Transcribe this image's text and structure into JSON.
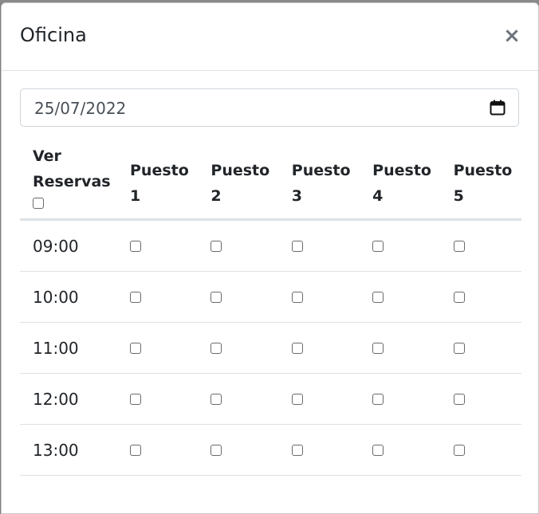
{
  "modal": {
    "title": "Oficina",
    "close_label": "×"
  },
  "date_field": {
    "value": "25/07/2022",
    "icon": "calendar-icon"
  },
  "table": {
    "first_header_line1": "Ver",
    "first_header_line2": "Reservas",
    "headers": [
      {
        "line1": "Puesto",
        "line2": "1"
      },
      {
        "line1": "Puesto",
        "line2": "2"
      },
      {
        "line1": "Puesto",
        "line2": "3"
      },
      {
        "line1": "Puesto",
        "line2": "4"
      },
      {
        "line1": "Puesto",
        "line2": "5"
      }
    ],
    "rows": [
      "09:00",
      "10:00",
      "11:00",
      "12:00",
      "13:00"
    ]
  }
}
